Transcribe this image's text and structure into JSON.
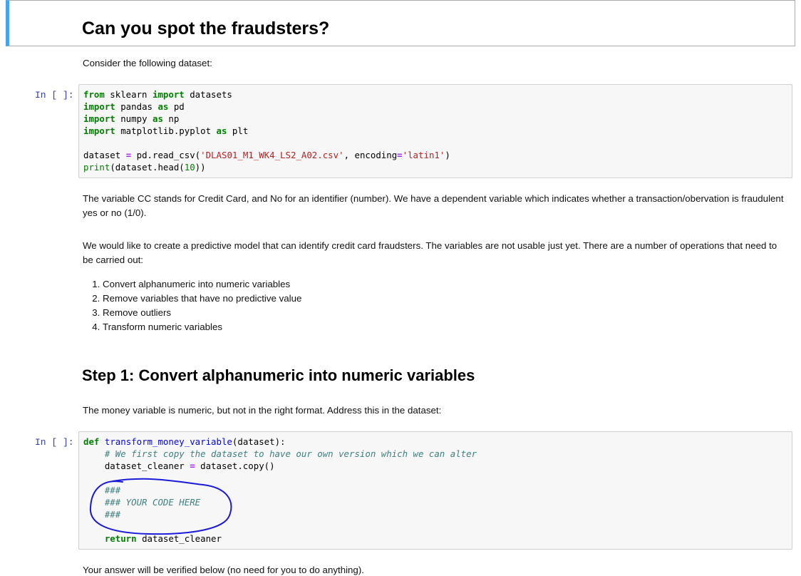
{
  "heading": "Can you spot the fraudsters?",
  "intro": "Consider the following dataset:",
  "prompt_label": "In [ ]:",
  "cell1": {
    "lines": [
      [
        {
          "t": "from",
          "c": "kw"
        },
        {
          "t": " sklearn ",
          "c": ""
        },
        {
          "t": "import",
          "c": "kw"
        },
        {
          "t": " datasets",
          "c": ""
        }
      ],
      [
        {
          "t": "import",
          "c": "kw"
        },
        {
          "t": " pandas ",
          "c": ""
        },
        {
          "t": "as",
          "c": "kw"
        },
        {
          "t": " pd",
          "c": ""
        }
      ],
      [
        {
          "t": "import",
          "c": "kw"
        },
        {
          "t": " numpy ",
          "c": ""
        },
        {
          "t": "as",
          "c": "kw"
        },
        {
          "t": " np",
          "c": ""
        }
      ],
      [
        {
          "t": "import",
          "c": "kw"
        },
        {
          "t": " matplotlib.pyplot ",
          "c": ""
        },
        {
          "t": "as",
          "c": "kw"
        },
        {
          "t": " plt",
          "c": ""
        }
      ],
      [],
      [
        {
          "t": "dataset ",
          "c": ""
        },
        {
          "t": "=",
          "c": "op"
        },
        {
          "t": " pd.read_csv(",
          "c": ""
        },
        {
          "t": "'DLAS01_M1_WK4_LS2_A02.csv'",
          "c": "str"
        },
        {
          "t": ", encoding",
          "c": ""
        },
        {
          "t": "=",
          "c": "op"
        },
        {
          "t": "'latin1'",
          "c": "str"
        },
        {
          "t": ")",
          "c": ""
        }
      ],
      [
        {
          "t": "print",
          "c": "bi"
        },
        {
          "t": "(dataset.head(",
          "c": ""
        },
        {
          "t": "10",
          "c": "num"
        },
        {
          "t": "))",
          "c": ""
        }
      ]
    ]
  },
  "para1": "The variable CC stands for Credit Card, and No for an identifier (number). We have a dependent variable which indicates whether a transaction/obervation is fraudulent yes or no (1/0).",
  "para2": "We would like to create a predictive model that can identify credit card fraudsters. The variables are not usable just yet. There are a number of operations that need to be carried out:",
  "steps": [
    "Convert alphanumeric into numeric variables",
    "Remove variables that have no predictive value",
    "Remove outliers",
    "Transform numeric variables"
  ],
  "step1_heading": "Step 1: Convert alphanumeric into numeric variables",
  "step1_text": "The money variable is numeric, but not in the right format. Address this in the dataset:",
  "cell2": {
    "lines": [
      [
        {
          "t": "def",
          "c": "kw"
        },
        {
          "t": " ",
          "c": ""
        },
        {
          "t": "transform_money_variable",
          "c": "fn"
        },
        {
          "t": "(dataset):",
          "c": ""
        }
      ],
      [
        {
          "t": "    ",
          "c": ""
        },
        {
          "t": "# We first copy the dataset to have our own version which we can alter",
          "c": "cm"
        }
      ],
      [
        {
          "t": "    dataset_cleaner ",
          "c": ""
        },
        {
          "t": "=",
          "c": "op"
        },
        {
          "t": " dataset.copy()",
          "c": ""
        }
      ],
      [],
      [
        {
          "t": "    ",
          "c": ""
        },
        {
          "t": "###",
          "c": "cm"
        }
      ],
      [
        {
          "t": "    ",
          "c": ""
        },
        {
          "t": "### YOUR CODE HERE",
          "c": "cm"
        }
      ],
      [
        {
          "t": "    ",
          "c": ""
        },
        {
          "t": "###",
          "c": "cm"
        }
      ],
      [],
      [
        {
          "t": "    ",
          "c": ""
        },
        {
          "t": "return",
          "c": "kw"
        },
        {
          "t": " dataset_cleaner",
          "c": ""
        }
      ]
    ]
  },
  "footer_text": "Your answer will be verified below (no need for you to do anything).",
  "colors": {
    "selected_cell_border": "#42a5f5",
    "prompt": "#303f9f",
    "code_bg": "#f7f7f7",
    "annotation_ink": "#1a1adb"
  }
}
